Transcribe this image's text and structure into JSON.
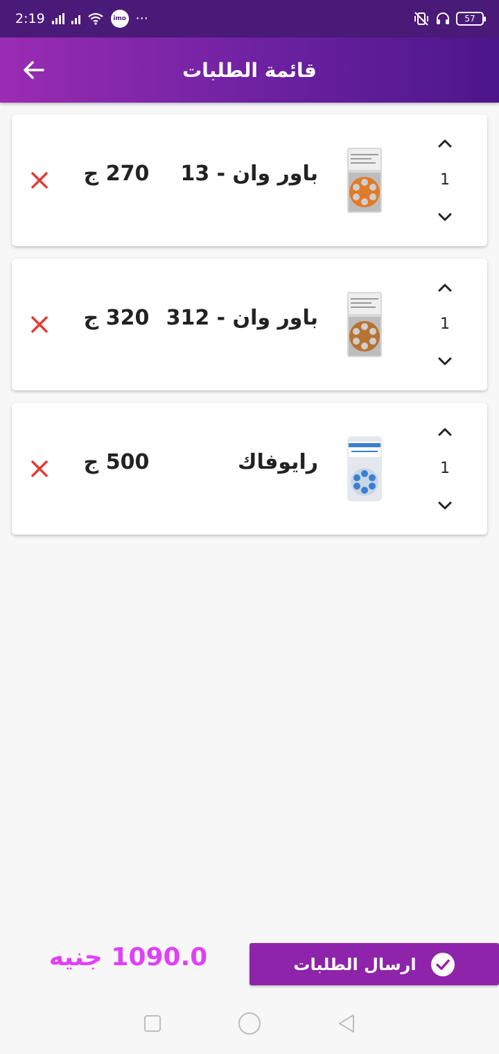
{
  "status_bar": {
    "time": "2:19",
    "dots": "···",
    "imo_label": "imo",
    "battery": "57"
  },
  "app_bar": {
    "title": "قائمة الطلبات"
  },
  "colors": {
    "app_bar_start": "#9a2cb3",
    "app_bar_end": "#4d168a",
    "accent": "#8e24aa",
    "total_text": "#e040fb",
    "remove_icon": "#e53935"
  },
  "icons": {
    "back": "arrow-left-icon",
    "remove": "close-icon",
    "increase": "chevron-up-icon",
    "decrease": "chevron-down-icon",
    "submit": "check-circle-icon"
  },
  "cart": {
    "items": [
      {
        "name": "باور وان - 13",
        "price": "270 ج",
        "quantity": "1",
        "image_accent": "#e07b2a"
      },
      {
        "name": "باور وان - 312",
        "price": "320 ج",
        "quantity": "1",
        "image_accent": "#b87333"
      },
      {
        "name": "رايوفاك",
        "price": "500 ج",
        "quantity": "1",
        "image_accent": "#3a7fd0"
      }
    ]
  },
  "footer": {
    "total": "1090.0 جنيه",
    "submit_label": "ارسال الطلبات"
  }
}
